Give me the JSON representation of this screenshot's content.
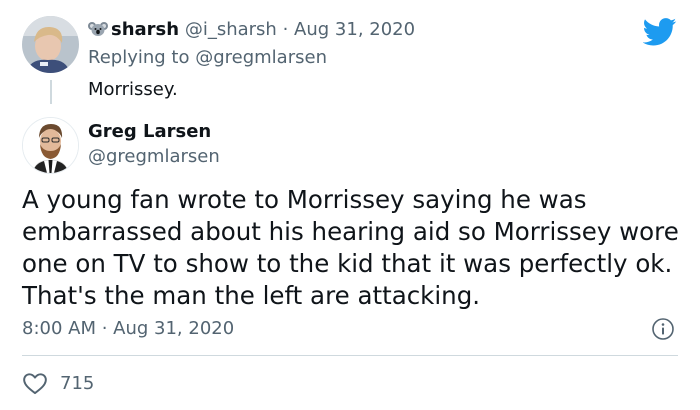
{
  "reply_tweet": {
    "display_name": "sharsh",
    "handle": "@i_sharsh",
    "separator": "·",
    "date": "Aug 31, 2020",
    "replying_prefix": "Replying to",
    "replying_handle": "@gregmlarsen",
    "text": "Morrissey.",
    "badge_icon": "koala-icon"
  },
  "main_tweet": {
    "display_name": "Greg Larsen",
    "handle": "@gregmlarsen",
    "lines": [
      "A young fan wrote to Morrissey saying he was",
      "embarrassed about his hearing aid so Morrissey wore",
      "one on TV to show to the kid that it was perfectly ok.",
      "That's the man the left are attacking."
    ],
    "timestamp": "8:00 AM · Aug 31, 2020",
    "likes": "715"
  },
  "icons": {
    "brand": "twitter-bird-icon",
    "info": "info-icon",
    "like": "heart-icon"
  },
  "colors": {
    "brand_blue": "#1d9bf0",
    "text": "#0f1419",
    "muted": "#536471",
    "divider": "#cfd9de"
  }
}
